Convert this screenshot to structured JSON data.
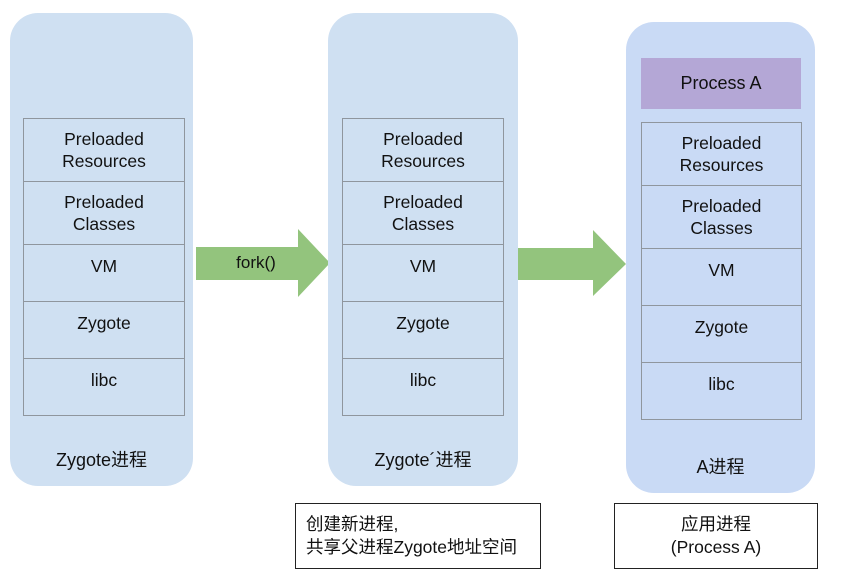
{
  "colors": {
    "panel_bg": "#cfe0f2",
    "panel_app_bg": "#c9daf5",
    "process_a_bg": "#b4a7d6",
    "arrow": "#93c47d",
    "cell_border": "#8f969e"
  },
  "panels": [
    {
      "cells": [
        "Preloaded\nResources",
        "Preloaded\nClasses",
        "VM",
        "Zygote",
        "libc"
      ],
      "label": "Zygote进程"
    },
    {
      "cells": [
        "Preloaded\nResources",
        "Preloaded\nClasses",
        "VM",
        "Zygote",
        "libc"
      ],
      "label": "Zygote´进程"
    },
    {
      "top_box": "Process A",
      "cells": [
        "Preloaded\nResources",
        "Preloaded\nClasses",
        "VM",
        "Zygote",
        "libc"
      ],
      "label": "A进程"
    }
  ],
  "arrows": [
    {
      "label": "fork()"
    },
    {
      "label": ""
    }
  ],
  "notes": [
    {
      "line1": "创建新进程,",
      "line2": "共享父进程Zygote地址空间"
    },
    {
      "line1": "应用进程",
      "line2": "(Process A)"
    }
  ]
}
